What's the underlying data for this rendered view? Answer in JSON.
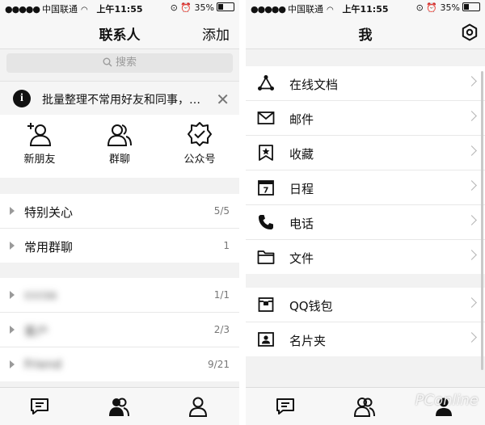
{
  "status": {
    "carrier": "中国联通",
    "time": "上午11:55",
    "battery": "35%"
  },
  "contacts": {
    "title": "联系人",
    "add_label": "添加",
    "search": {
      "placeholder": "搜索"
    },
    "tip": {
      "text": "批量整理不常用好友和同事，办..."
    },
    "quick": [
      {
        "label": "新朋友",
        "icon": "new-friend-icon"
      },
      {
        "label": "群聊",
        "icon": "group-chat-icon"
      },
      {
        "label": "公众号",
        "icon": "official-account-icon"
      }
    ],
    "groups_main": [
      {
        "name": "特别关心",
        "count": "5/5"
      },
      {
        "name": "常用群聊",
        "count": "1"
      }
    ],
    "groups_blurred": [
      {
        "name": "cccss",
        "count": "1/1"
      },
      {
        "name": "客户",
        "count": "2/3"
      },
      {
        "name": "Friend",
        "count": "9/21"
      }
    ]
  },
  "me": {
    "title": "我",
    "menu1": [
      {
        "label": "在线文档",
        "icon": "online-docs-icon"
      },
      {
        "label": "邮件",
        "icon": "mail-icon"
      },
      {
        "label": "收藏",
        "icon": "favorites-icon"
      },
      {
        "label": "日程",
        "icon": "calendar-icon"
      },
      {
        "label": "电话",
        "icon": "phone-icon"
      },
      {
        "label": "文件",
        "icon": "folder-icon"
      }
    ],
    "menu2": [
      {
        "label": "QQ钱包",
        "icon": "wallet-icon"
      },
      {
        "label": "名片夹",
        "icon": "card-holder-icon"
      }
    ],
    "calendar_day": "7"
  },
  "watermark": "PConline"
}
